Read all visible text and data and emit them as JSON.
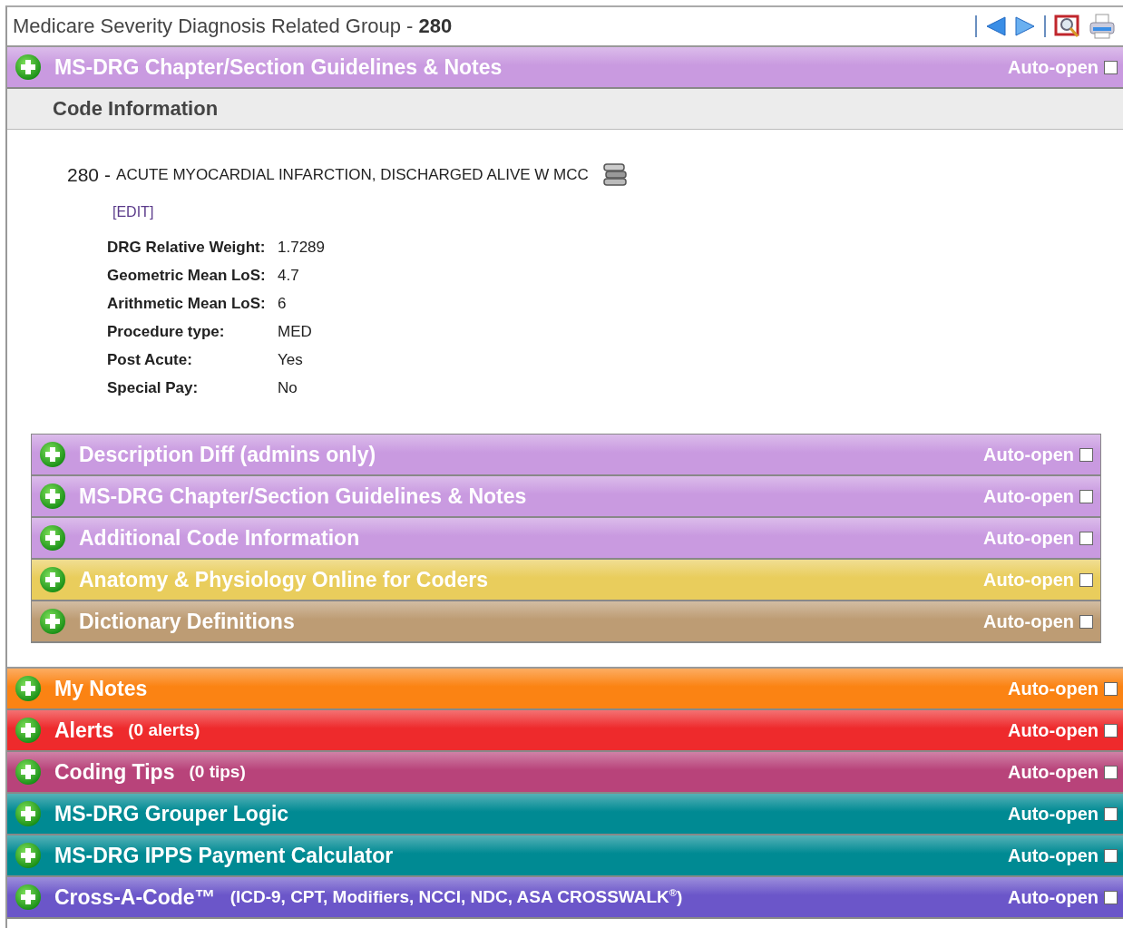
{
  "header": {
    "title": "Medicare Severity Diagnosis Related Group - ",
    "code": "280",
    "toolbar": [
      {
        "kind": "separator"
      },
      {
        "kind": "prev"
      },
      {
        "kind": "next"
      },
      {
        "kind": "separator"
      },
      {
        "kind": "lookup"
      },
      {
        "kind": "print"
      }
    ]
  },
  "top_panels": [
    {
      "title": "MS-DRG Chapter/Section Guidelines & Notes",
      "color": "#c99ae0",
      "auto_open_label": "Auto-open",
      "auto_open": false
    }
  ],
  "code_information": {
    "heading": "Code Information",
    "code": "280",
    "separator": "-",
    "description": "ACUTE MYOCARDIAL INFARCTION, DISCHARGED ALIVE W MCC",
    "edit_link": "[EDIT]",
    "fields": [
      {
        "label": "DRG Relative Weight:",
        "value": "1.7289"
      },
      {
        "label": "Geometric Mean LoS:",
        "value": "4.7"
      },
      {
        "label": "Arithmetic Mean LoS:",
        "value": "6"
      },
      {
        "label": "Procedure type:",
        "value": "MED"
      },
      {
        "label": "Post Acute:",
        "value": "Yes"
      },
      {
        "label": "Special Pay:",
        "value": "No"
      }
    ],
    "panels": [
      {
        "title": "Description Diff (admins only)",
        "color": "#c99ae0",
        "auto_open_label": "Auto-open",
        "auto_open": false
      },
      {
        "title": "MS-DRG Chapter/Section Guidelines & Notes",
        "color": "#c99ae0",
        "auto_open_label": "Auto-open",
        "auto_open": false
      },
      {
        "title": "Additional Code Information",
        "color": "#c99ae0",
        "auto_open_label": "Auto-open",
        "auto_open": false
      },
      {
        "title": "Anatomy & Physiology Online for Coders",
        "color": "#e9cd5c",
        "auto_open_label": "Auto-open",
        "auto_open": false
      },
      {
        "title": "Dictionary Definitions",
        "color": "#bd9c74",
        "auto_open_label": "Auto-open",
        "auto_open": false
      }
    ]
  },
  "bottom_panels": [
    {
      "title": "My Notes",
      "color": "#fb8313",
      "auto_open_label": "Auto-open",
      "auto_open": false
    },
    {
      "title": "Alerts",
      "subtitle": "(0 alerts)",
      "color": "#ee2a2c",
      "auto_open_label": "Auto-open",
      "auto_open": false
    },
    {
      "title": "Coding Tips",
      "subtitle": "(0 tips)",
      "color": "#b8437a",
      "auto_open_label": "Auto-open",
      "auto_open": false
    },
    {
      "title": "MS-DRG Grouper Logic",
      "color": "#008a93",
      "auto_open_label": "Auto-open",
      "auto_open": false
    },
    {
      "title": "MS-DRG IPPS Payment Calculator",
      "color": "#008a93",
      "auto_open_label": "Auto-open",
      "auto_open": false
    },
    {
      "title": "Cross-A-Code™",
      "subtitle": "(ICD-9, CPT, Modifiers, NCCI, NDC, ASA CROSSWALK$^{®}$)",
      "color": "#6b56c9",
      "auto_open_label": "Auto-open",
      "auto_open": false
    }
  ]
}
